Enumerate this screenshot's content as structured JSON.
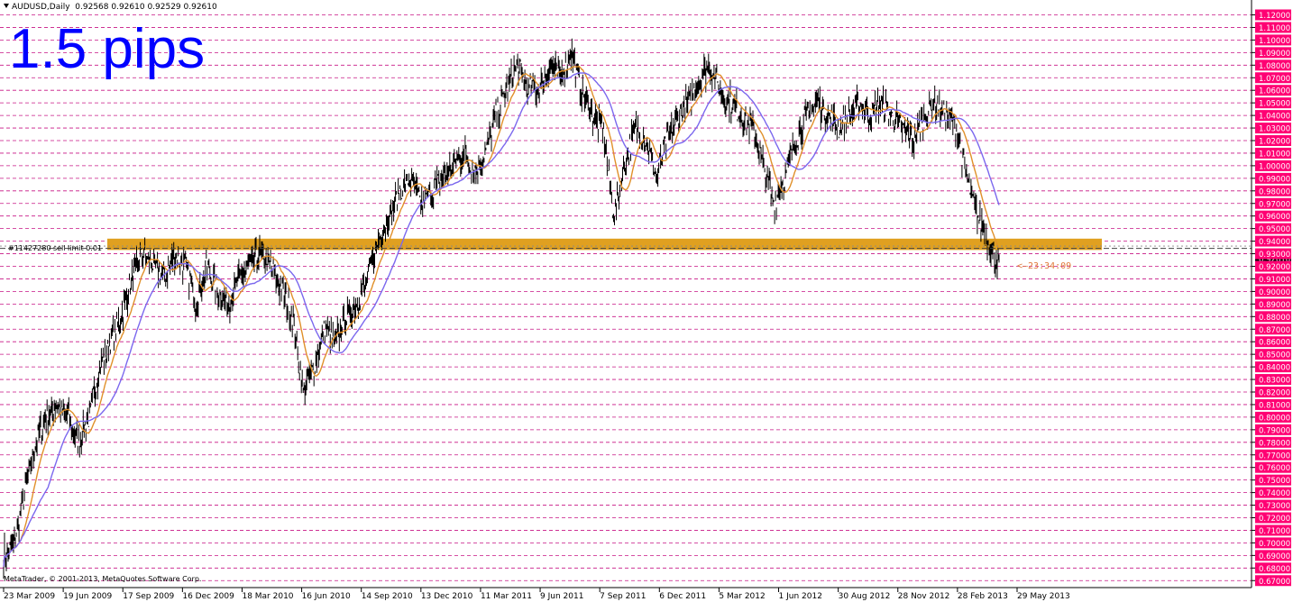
{
  "header": {
    "symbol": "AUDUSD,Daily",
    "ohlc": "0.92568 0.92610 0.92529 0.92610"
  },
  "overlay_text": "1.5 pips",
  "order_label": "#11427280 sell limit 0.01",
  "countdown": "<—23:34:09",
  "copyright": "MetaTrader, © 2001-2013, MetaQuotes Software Corp.",
  "price_label_current": "0.92610",
  "colors": {
    "background": "#ffffff",
    "grid": "#c71585",
    "candles": "#000000",
    "fast_ma": "#e0902a",
    "slow_ma": "#7b68ee",
    "zone": "#e0a020",
    "price_tag": "#ff0073",
    "overlay_text": "#0000ff",
    "countdown": "#e07838"
  },
  "chart_data": {
    "type": "line",
    "symbol": "AUDUSD",
    "timeframe": "Daily",
    "y_ticks": [
      "1.12000",
      "1.11000",
      "1.10000",
      "1.09000",
      "1.08000",
      "1.07000",
      "1.06000",
      "1.05000",
      "1.04000",
      "1.03000",
      "1.02000",
      "1.01000",
      "1.00000",
      "0.99000",
      "0.98000",
      "0.97000",
      "0.96000",
      "0.95000",
      "0.94000",
      "0.93000",
      "0.92000",
      "0.91000",
      "0.90000",
      "0.89000",
      "0.88000",
      "0.87000",
      "0.86000",
      "0.85000",
      "0.84000",
      "0.83000",
      "0.82000",
      "0.81000",
      "0.80000",
      "0.79000",
      "0.78000",
      "0.77000",
      "0.76000",
      "0.75000",
      "0.74000",
      "0.73000",
      "0.72000",
      "0.71000",
      "0.70000",
      "0.69000",
      "0.68000",
      "0.67000"
    ],
    "ylim": [
      0.67,
      1.12
    ],
    "grid": true,
    "x_ticks": [
      "23 Mar 2009",
      "19 Jun 2009",
      "17 Sep 2009",
      "16 Dec 2009",
      "18 Mar 2010",
      "16 Jun 2010",
      "14 Sep 2010",
      "13 Dec 2010",
      "11 Mar 2011",
      "9 Jun 2011",
      "7 Sep 2011",
      "6 Dec 2011",
      "5 Mar 2012",
      "1 Jun 2012",
      "30 Aug 2012",
      "28 Nov 2012",
      "28 Feb 2013",
      "29 May 2013"
    ],
    "price_path": [
      [
        0,
        0.69
      ],
      [
        1,
        0.7
      ],
      [
        2,
        0.74
      ],
      [
        3,
        0.78
      ],
      [
        4,
        0.8
      ],
      [
        5,
        0.81
      ],
      [
        6,
        0.8
      ],
      [
        7,
        0.78
      ],
      [
        8,
        0.8
      ],
      [
        9,
        0.84
      ],
      [
        10,
        0.86
      ],
      [
        11,
        0.88
      ],
      [
        12,
        0.91
      ],
      [
        13,
        0.93
      ],
      [
        14,
        0.92
      ],
      [
        15,
        0.91
      ],
      [
        16,
        0.93
      ],
      [
        17,
        0.92
      ],
      [
        18,
        0.89
      ],
      [
        19,
        0.92
      ],
      [
        20,
        0.9
      ],
      [
        21,
        0.89
      ],
      [
        22,
        0.91
      ],
      [
        23,
        0.92
      ],
      [
        24,
        0.93
      ],
      [
        25,
        0.92
      ],
      [
        26,
        0.9
      ],
      [
        27,
        0.88
      ],
      [
        28,
        0.82
      ],
      [
        29,
        0.84
      ],
      [
        30,
        0.87
      ],
      [
        31,
        0.86
      ],
      [
        32,
        0.88
      ],
      [
        33,
        0.89
      ],
      [
        34,
        0.91
      ],
      [
        35,
        0.94
      ],
      [
        36,
        0.96
      ],
      [
        37,
        0.98
      ],
      [
        38,
        0.99
      ],
      [
        39,
        0.97
      ],
      [
        40,
        0.98
      ],
      [
        41,
        0.99
      ],
      [
        42,
        1.0
      ],
      [
        43,
        1.01
      ],
      [
        44,
        0.995
      ],
      [
        45,
        1.01
      ],
      [
        46,
        1.04
      ],
      [
        47,
        1.06
      ],
      [
        48,
        1.08
      ],
      [
        49,
        1.06
      ],
      [
        50,
        1.06
      ],
      [
        51,
        1.08
      ],
      [
        52,
        1.07
      ],
      [
        53,
        1.09
      ],
      [
        54,
        1.06
      ],
      [
        55,
        1.04
      ],
      [
        56,
        1.03
      ],
      [
        57,
        0.96
      ],
      [
        58,
        1.0
      ],
      [
        59,
        1.03
      ],
      [
        60,
        1.02
      ],
      [
        61,
        0.99
      ],
      [
        62,
        1.02
      ],
      [
        63,
        1.04
      ],
      [
        64,
        1.05
      ],
      [
        65,
        1.07
      ],
      [
        66,
        1.08
      ],
      [
        67,
        1.06
      ],
      [
        68,
        1.05
      ],
      [
        69,
        1.04
      ],
      [
        70,
        1.03
      ],
      [
        71,
        1.0
      ],
      [
        72,
        0.97
      ],
      [
        73,
        0.99
      ],
      [
        74,
        1.02
      ],
      [
        75,
        1.04
      ],
      [
        76,
        1.05
      ],
      [
        77,
        1.04
      ],
      [
        78,
        1.03
      ],
      [
        79,
        1.04
      ],
      [
        80,
        1.05
      ],
      [
        81,
        1.04
      ],
      [
        82,
        1.05
      ],
      [
        83,
        1.04
      ],
      [
        84,
        1.03
      ],
      [
        85,
        1.02
      ],
      [
        86,
        1.04
      ],
      [
        87,
        1.05
      ],
      [
        88,
        1.04
      ],
      [
        89,
        1.03
      ],
      [
        90,
        0.99
      ],
      [
        91,
        0.96
      ],
      [
        92,
        0.94
      ],
      [
        93,
        0.92
      ]
    ],
    "x_path_max": 93,
    "fast_ma_period_note": "",
    "sell_limit_price": 0.935,
    "zone": {
      "from": 0.933,
      "to": 0.942
    },
    "current_price": 0.9261
  }
}
